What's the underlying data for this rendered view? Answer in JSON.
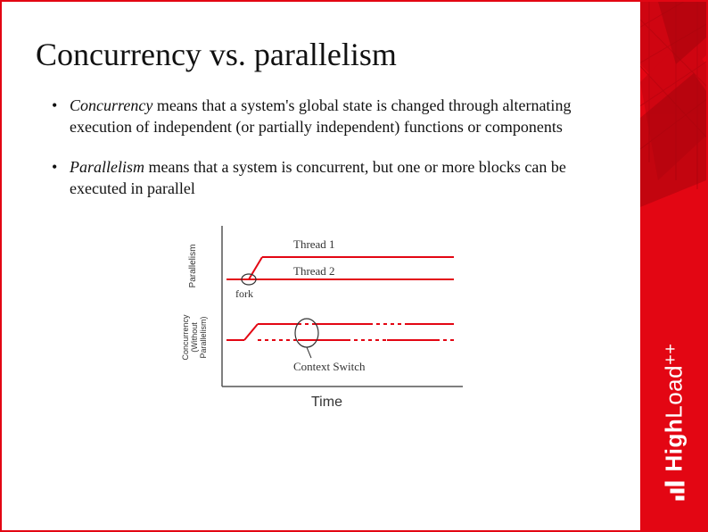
{
  "title": "Concurrency vs. parallelism",
  "bullets": [
    {
      "term": "Concurrency",
      "rest": " means that a system's global state is changed through alternating execution of independent (or partially independent) functions or components"
    },
    {
      "term": "Parallelism",
      "rest": " means that a system is concurrent, but one or more blocks can be executed in parallel"
    }
  ],
  "diagram": {
    "y_labels": {
      "top": "Parallelism",
      "bottom": "Concurrency (Without Parallelism)"
    },
    "x_label": "Time",
    "annotations": {
      "thread1": "Thread 1",
      "thread2": "Thread 2",
      "fork": "fork",
      "context_switch": "Context Switch"
    }
  },
  "brand": {
    "name_bold": "High",
    "name_light": "Load",
    "suffix": "++"
  },
  "colors": {
    "accent": "#e30613"
  }
}
